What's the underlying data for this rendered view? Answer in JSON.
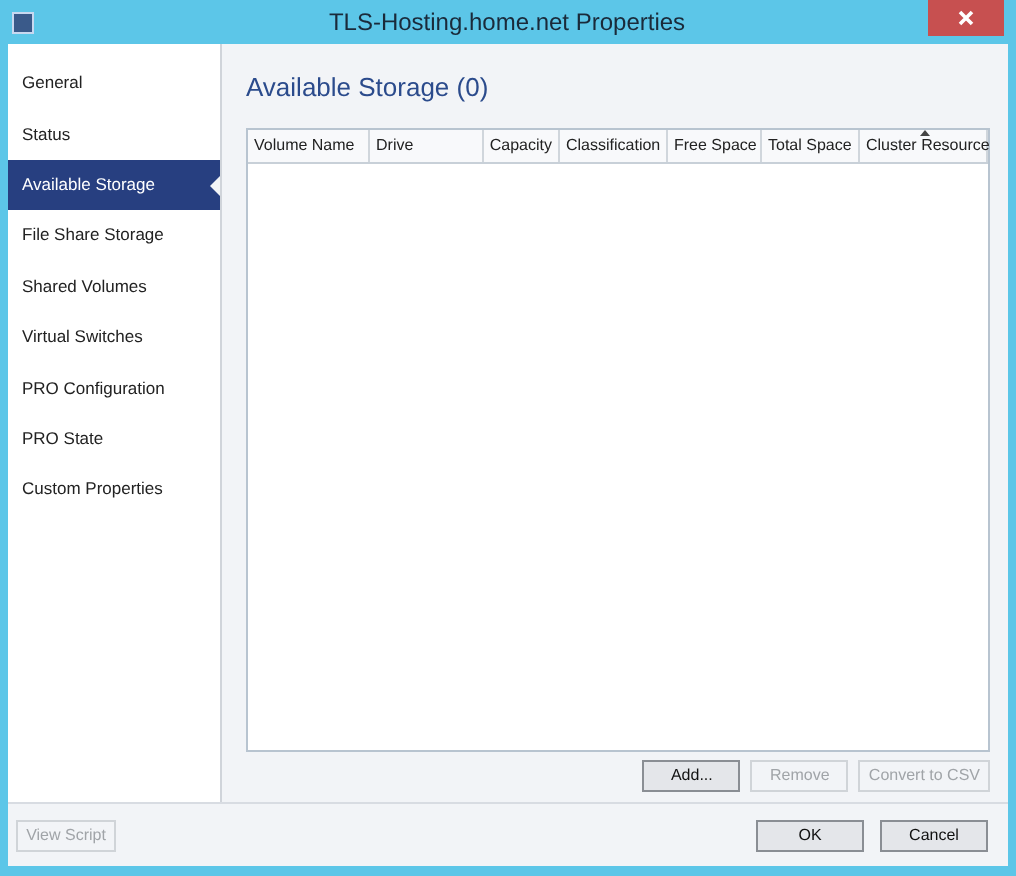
{
  "window": {
    "title": "TLS-Hosting.home.net Properties"
  },
  "sidebar": {
    "items": [
      {
        "label": "General",
        "selected": false
      },
      {
        "label": "Status",
        "selected": false
      },
      {
        "label": "Available Storage",
        "selected": true
      },
      {
        "label": "File Share Storage",
        "selected": false
      },
      {
        "label": "Shared Volumes",
        "selected": false
      },
      {
        "label": "Virtual Switches",
        "selected": false
      },
      {
        "label": "PRO Configuration",
        "selected": false
      },
      {
        "label": "PRO State",
        "selected": false
      },
      {
        "label": "Custom Properties",
        "selected": false
      }
    ]
  },
  "heading": "Available Storage (0)",
  "table": {
    "columns": [
      {
        "label": "Volume Name",
        "sorted": false
      },
      {
        "label": "Drive",
        "sorted": false
      },
      {
        "label": "Capacity",
        "sorted": false
      },
      {
        "label": "Classification",
        "sorted": false
      },
      {
        "label": "Free Space",
        "sorted": false
      },
      {
        "label": "Total Space",
        "sorted": false
      },
      {
        "label": "Cluster Resource",
        "sorted": true
      }
    ]
  },
  "table_buttons": [
    {
      "label": "Add...",
      "disabled": false
    },
    {
      "label": "Remove",
      "disabled": true
    },
    {
      "label": "Convert to CSV",
      "disabled": true
    }
  ],
  "footer_left": [
    {
      "label": "View Script",
      "disabled": true
    }
  ],
  "footer_right": [
    {
      "label": "OK",
      "disabled": false
    },
    {
      "label": "Cancel",
      "disabled": false
    }
  ]
}
